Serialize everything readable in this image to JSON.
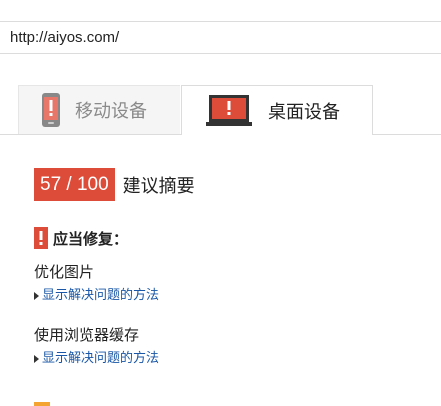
{
  "url_bar": {
    "value": "http://aiyos.com/"
  },
  "tabs": [
    {
      "label": "移动设备",
      "icon": "mobile-phone-icon",
      "active": false
    },
    {
      "label": "桌面设备",
      "icon": "desktop-monitor-icon",
      "active": true
    }
  ],
  "summary": {
    "score": "57 / 100",
    "title": "建议摘要"
  },
  "should_fix": {
    "heading": "应当修复：",
    "icon": "warning-exclamation-icon",
    "issues": [
      {
        "title": "优化图片",
        "link": "显示解决问题的方法"
      },
      {
        "title": "使用浏览器缓存",
        "link": "显示解决问题的方法"
      }
    ]
  },
  "colors": {
    "error_red": "#dd4b39",
    "link_blue": "#1a57a6",
    "consider_orange": "#f4a430",
    "tab_inactive_bg": "#f5f5f5"
  }
}
